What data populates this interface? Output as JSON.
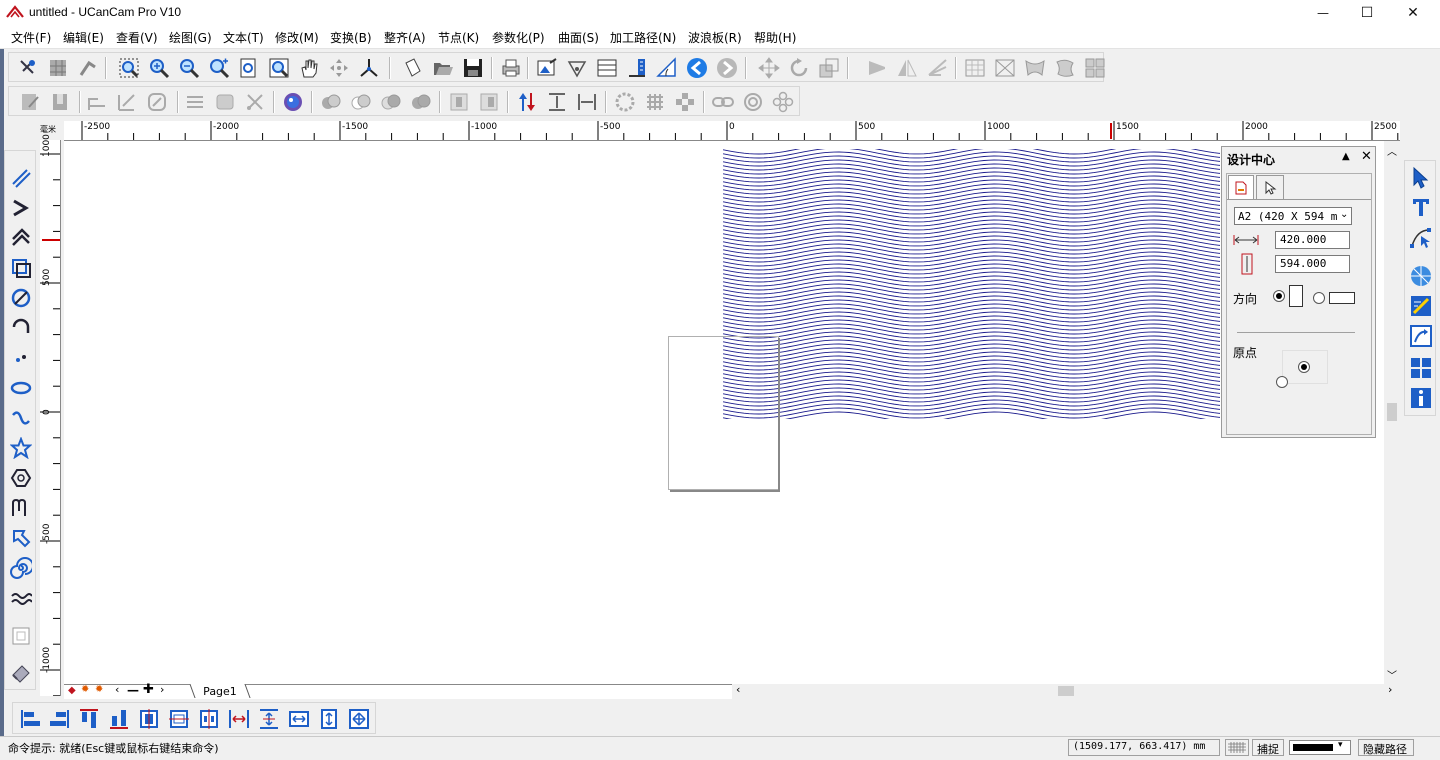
{
  "window": {
    "title": "untitled - UCanCam Pro V10",
    "minimize": "—",
    "maximize": "☐",
    "close": "✕"
  },
  "menu": [
    "文件(F)",
    "编辑(E)",
    "查看(V)",
    "绘图(G)",
    "文本(T)",
    "修改(M)",
    "变换(B)",
    "整齐(A)",
    "节点(K)",
    "参数化(P)",
    "曲面(S)",
    "加工路径(N)",
    "波浪板(R)",
    "帮助(H)"
  ],
  "rulers": {
    "h_labels": [
      "-2500",
      "-2000",
      "-1500",
      "-1000",
      "-500",
      "0",
      "500",
      "1000",
      "1500",
      "2000",
      "2500"
    ],
    "v_labels": [
      "1000",
      "500",
      "0",
      "-500",
      "-1000"
    ],
    "corner": "毫米"
  },
  "design_panel": {
    "title": "设计中心",
    "paper_size": "A2 (420 X 594 m",
    "width_value": "420.000",
    "height_value": "594.000",
    "orientation_label": "方向",
    "origin_label": "原点"
  },
  "page_tabs": {
    "tab": "Page1"
  },
  "status": {
    "hint": "命令提示: 就绪(Esc键或鼠标右键结束命令)",
    "coords": "(1509.177,   663.417) mm",
    "snap": "捕捉",
    "hide_path": "隐藏路径"
  },
  "colors": {
    "wave_line": "#1a1a8c",
    "accent_blue": "#1e5fc7",
    "ruler_marker": "#cc0000"
  }
}
